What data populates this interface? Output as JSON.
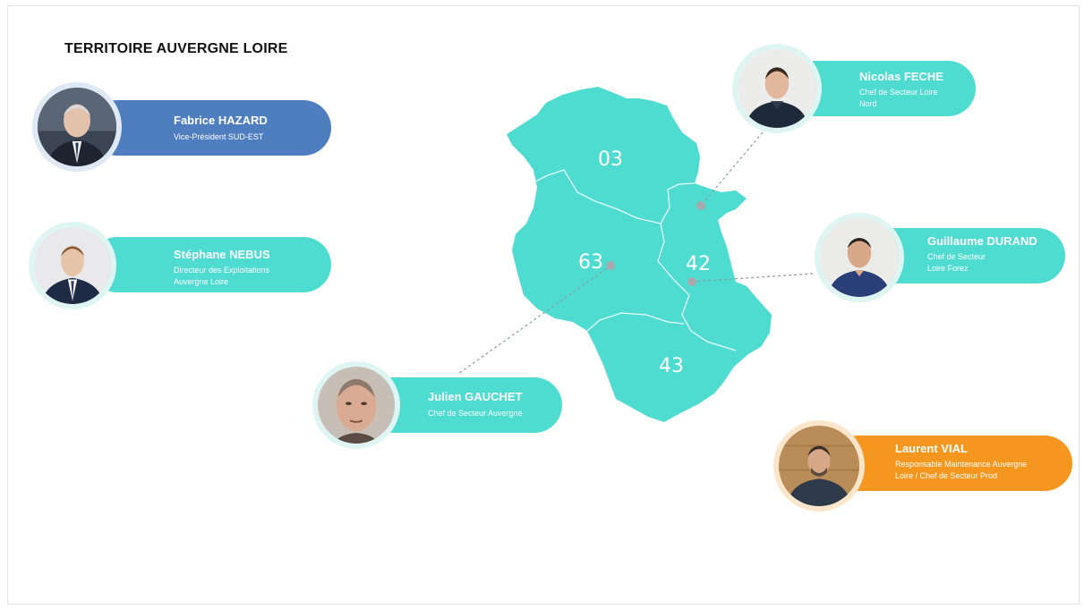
{
  "title": "TERRITOIRE AUVERGNE LOIRE",
  "colors": {
    "teal": "#4fdcd0",
    "blue": "#4f7ec0",
    "orange": "#f5961e",
    "ring": "#dff5f3"
  },
  "departments": [
    {
      "code": "03"
    },
    {
      "code": "63"
    },
    {
      "code": "42"
    },
    {
      "code": "43"
    }
  ],
  "people": {
    "fabrice": {
      "name": "Fabrice HAZARD",
      "role_lines": [
        "Vice-Président SUD-EST"
      ],
      "photo_icon": "person-photo"
    },
    "stephane": {
      "name": "Stéphane NEBUS",
      "role_lines": [
        "Directeur des Exploitations",
        "Auvergne Loire"
      ],
      "photo_icon": "person-photo"
    },
    "julien": {
      "name": "Julien GAUCHET",
      "role_lines": [
        "Chef de Secteur Auvergne"
      ],
      "photo_icon": "person-photo"
    },
    "nicolas": {
      "name": "Nicolas FECHE",
      "role_lines": [
        "Chef de Secteur Loire",
        "Nord"
      ],
      "photo_icon": "person-photo"
    },
    "guillaume": {
      "name": "Guillaume DURAND",
      "role_lines": [
        "Chef de Secteur",
        "Loire Forez"
      ],
      "photo_icon": "person-photo"
    },
    "laurent": {
      "name": "Laurent VIAL",
      "role_lines": [
        "Responsable Maintenance Auvergne",
        "Loire / Chef de Secteur Prod"
      ],
      "photo_icon": "person-photo"
    }
  }
}
